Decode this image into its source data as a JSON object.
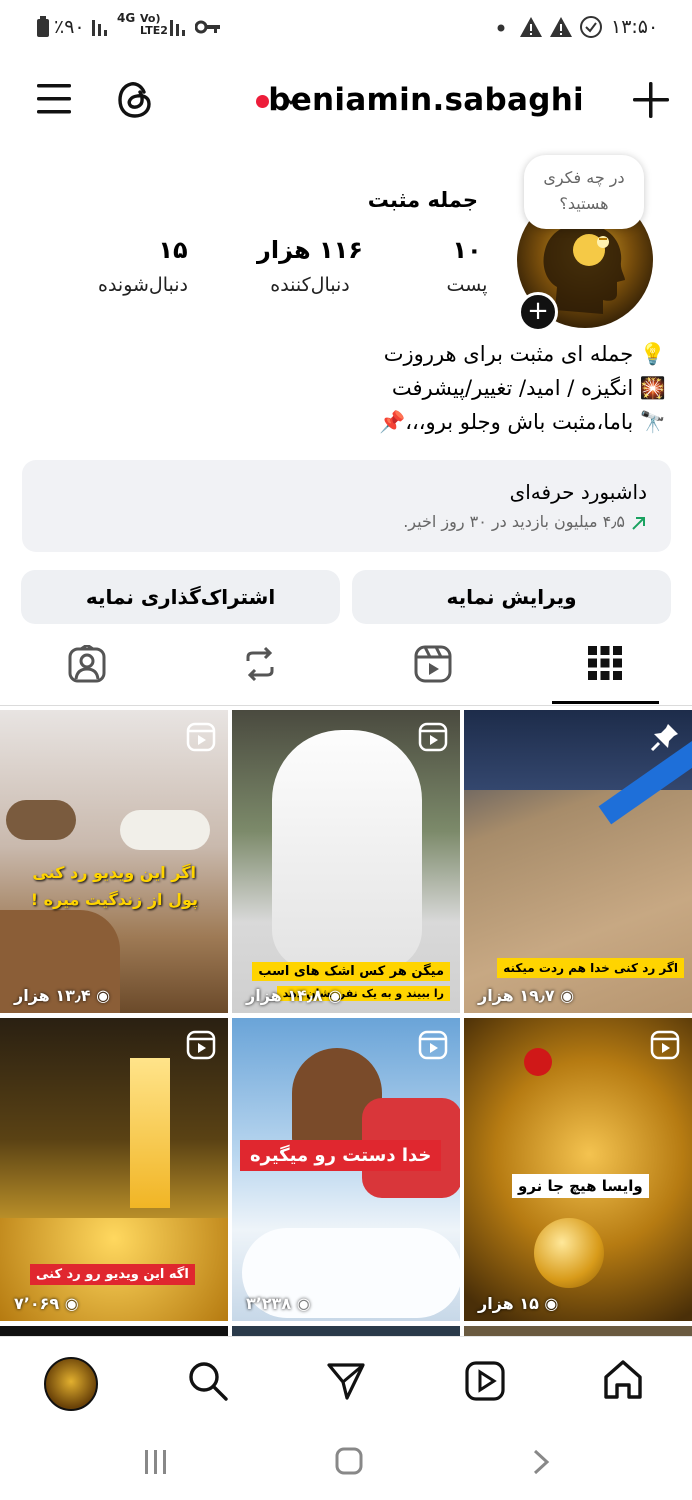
{
  "status_bar": {
    "battery": "٪۹۰",
    "network": "4G",
    "lte": "Vo) LTE2",
    "time": "۱۳:۵۰"
  },
  "header": {
    "username": "beniamin.sabaghi",
    "account_switch_icon": "chevron-down-icon",
    "menu_icon": "hamburger-icon",
    "threads_icon": "threads-icon",
    "create_icon": "plus-icon",
    "live_dot_color": "#ed1d3a"
  },
  "profile": {
    "name": "جمله مثبت",
    "note_bubble": {
      "line1": "در چه فکری",
      "line2": "هستید؟"
    },
    "stats": [
      {
        "value": "۱۰",
        "label": "پست"
      },
      {
        "value": "۱۱۶ هزار",
        "label": "دنبال‌کننده"
      },
      {
        "value": "۱۵",
        "label": "دنبال‌شونده"
      }
    ],
    "bio_lines": [
      "💡 جمله ای مثبت برای هرروزت",
      "🎇 انگیزه / امید/ تغییر/پیشرفت",
      "🔭 باما،مثبت باش وجلو برو،،،📌"
    ]
  },
  "dashboard": {
    "title": "داشبورد حرفه‌ای",
    "subtitle": "۴٫۵ میلیون بازدید در ۳۰ روز اخیر.",
    "trend_color": "#1aa260"
  },
  "buttons": {
    "edit": "ویرایش نمایه",
    "share": "اشتراک‌گذاری نمایه"
  },
  "tabs": [
    "grid-icon",
    "reels-icon",
    "reposts-icon",
    "tagged-icon"
  ],
  "posts": [
    {
      "caption": "اگر رد کنی خدا هم ردت میکنه",
      "views": "۱۹٫۷ هزار",
      "badge": "pin-icon",
      "caption_bg": "#ffd400",
      "caption_fg": "#000"
    },
    {
      "caption": "میگن هر کس اشک های اسب",
      "caption2": "را ببیند و به یک نفر نشان دهد",
      "views": "۱۴٫۸ هزار",
      "badge": "reel-icon",
      "caption_bg": "#ffd400",
      "caption_fg": "#000"
    },
    {
      "caption": "اگر این ویدیو رد کنی",
      "caption2": "پول از زندگیت میره !",
      "views": "۱۳٫۴ هزار",
      "badge": "reel-icon",
      "caption_bg": "transparent",
      "caption_fg": "#ffd400"
    },
    {
      "caption": "وایسا هیچ جا نرو",
      "views": "۱۵ هزار",
      "badge": "reel-icon",
      "caption_bg": "#ffffff",
      "caption_fg": "#000"
    },
    {
      "caption": "خدا دستت رو میگیره",
      "views": "۳٬۲۳۸",
      "badge": "reel-icon",
      "caption_bg": "#e0272f",
      "caption_fg": "#fff"
    },
    {
      "caption": "اگه این ویدیو رو رد کنی",
      "views": "۷٬۰۶۹",
      "badge": "reel-icon",
      "caption_bg": "#e0272f",
      "caption_fg": "#fff"
    }
  ],
  "bottom_nav": [
    "home-icon",
    "reels-icon",
    "send-icon",
    "search-icon",
    "profile-avatar"
  ]
}
